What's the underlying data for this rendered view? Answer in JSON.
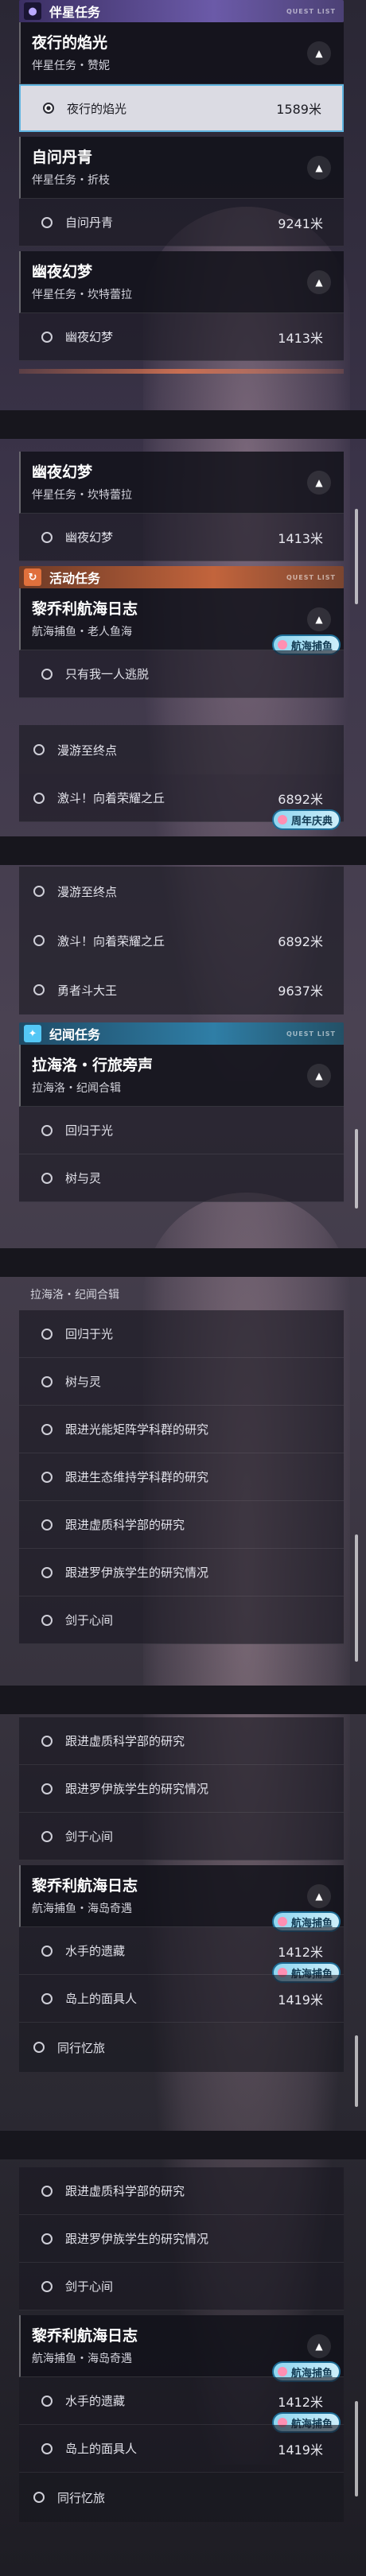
{
  "categories": {
    "companion": "伴星任务",
    "event": "活动任务",
    "travel": "纪闻任务",
    "tag": "QUEST LIST"
  },
  "q": {
    "night_flame": {
      "title": "夜行的焰光",
      "sub": "伴星任务・赞妮"
    },
    "self_ask": {
      "title": "自问丹青",
      "sub": "伴星任务・折枝"
    },
    "phantom": {
      "title": "幽夜幻梦",
      "sub": "伴星任务・坎特蕾拉"
    },
    "lijoli1": {
      "title": "黎乔利航海日志",
      "sub": "航海捕鱼・老人鱼海"
    },
    "lahailuo": {
      "title": "拉海洛・行旅旁声",
      "sub": "拉海洛・纪闻合辑"
    },
    "lijoli2": {
      "title": "黎乔利航海日志",
      "sub": "航海捕鱼・海岛奇遇"
    }
  },
  "s": {
    "night_flame": "夜行的焰光",
    "night_flame_d": "1589米",
    "self_ask": "自问丹青",
    "self_ask_d": "9241米",
    "phantom": "幽夜幻梦",
    "phantom_d": "1413米",
    "alone": "只有我一人逃脱",
    "drift": "漫游至终点",
    "hill": "激斗！向着荣耀之丘",
    "hill_d": "6892米",
    "brave": "勇者斗大王",
    "brave_d": "9637米",
    "light": "回归于光",
    "tree": "树与灵",
    "r1": "跟进光能矩阵学科群的研究",
    "r2": "跟进生态维持学科群的研究",
    "r3": "跟进虚质科学部的研究",
    "r4": "跟进罗伊族学生的研究情况",
    "r5": "剑于心间",
    "relic": "水手的遗藏",
    "relic_d": "1412米",
    "mask": "岛上的面具人",
    "mask_d": "1419米",
    "memory": "同行忆旅"
  },
  "badges": {
    "fishing": "航海捕鱼",
    "anniv": "周年庆典"
  },
  "colors": {
    "companion": "#6b5aa8",
    "event": "#c2643c",
    "travel": "#2f7ea6",
    "active_border": "#5fb4e0"
  },
  "icons": {
    "companion": "person-icon",
    "event": "swirl-icon",
    "travel": "sparkle-icon"
  }
}
